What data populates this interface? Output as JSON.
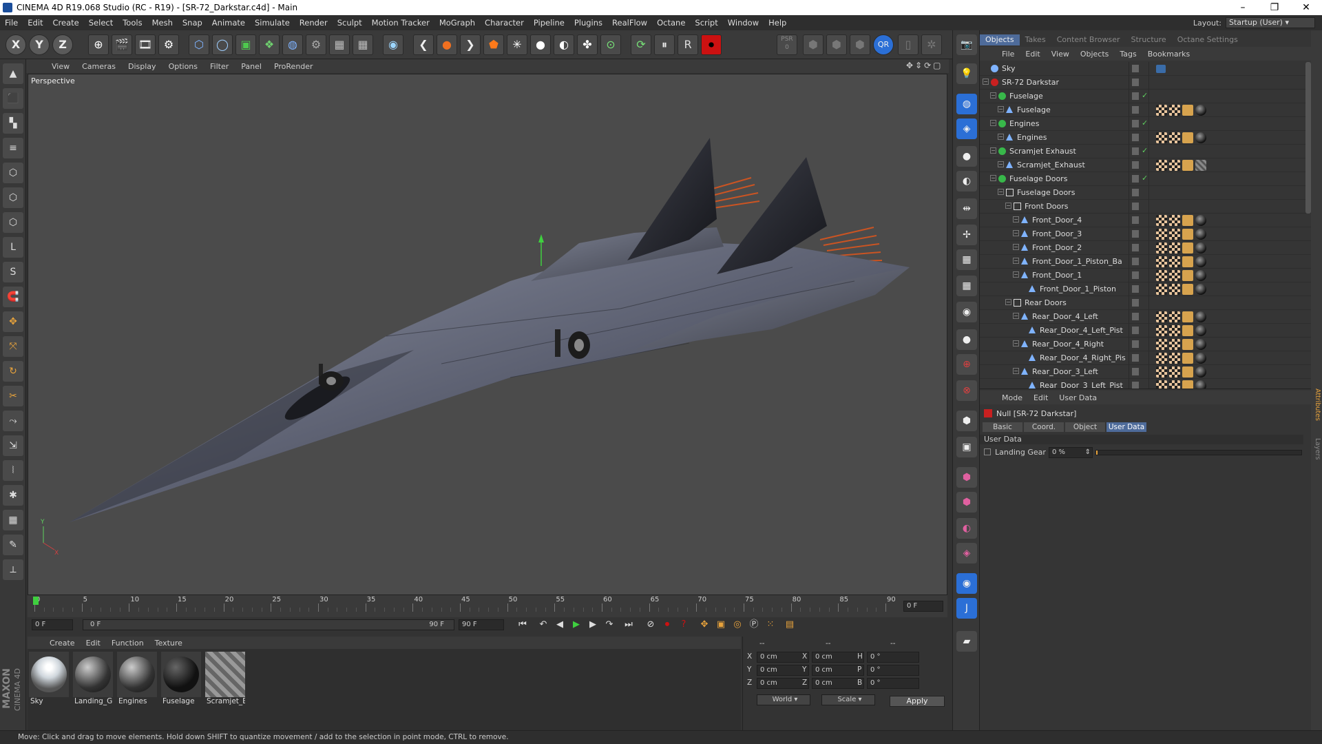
{
  "window": {
    "title": "CINEMA 4D R19.068 Studio (RC - R19) - [SR-72_Darkstar.c4d] - Main",
    "minimize": "–",
    "maximize": "❐",
    "close": "✕"
  },
  "menubar": [
    "File",
    "Edit",
    "Create",
    "Select",
    "Tools",
    "Mesh",
    "Snap",
    "Animate",
    "Simulate",
    "Render",
    "Sculpt",
    "Motion Tracker",
    "MoGraph",
    "Character",
    "Pipeline",
    "Plugins",
    "RealFlow",
    "Octane",
    "Script",
    "Window",
    "Help"
  ],
  "layout": {
    "label": "Layout:",
    "value": "Startup (User)"
  },
  "toolbar": {
    "axes": [
      "X",
      "Y",
      "Z"
    ],
    "icons": [
      "coord-system-icon",
      "render-view-icon",
      "render-picture-viewer-icon",
      "render-settings-icon",
      "cube-icon",
      "nurbs-icon",
      "array-icon",
      "deformer-icon",
      "sphere-field-icon",
      "camera-gear-icon",
      "scene-icon",
      "floor-grid-icon",
      "octane-live-icon",
      "prev-icon",
      "octane-material-icon",
      "next-icon",
      "octane-object-icon",
      "octane-settings-icon",
      "octane-light-icon",
      "octane-sphere-icon",
      "octane-arrow-icon",
      "octane-pivot-icon",
      "octane-refresh-icon",
      "octane-pause-icon",
      "octane-restart-icon",
      "octane-record-icon",
      "psr-icon",
      "qr-icon"
    ],
    "psr_label": "PSR",
    "psr_value": "0",
    "qr_label": "QR"
  },
  "viewport": {
    "menu": [
      "View",
      "Cameras",
      "Display",
      "Options",
      "Filter",
      "Panel",
      "ProRender"
    ],
    "name": "Perspective"
  },
  "timeline": {
    "ticks": [
      "0",
      "5",
      "10",
      "15",
      "20",
      "25",
      "30",
      "35",
      "40",
      "45",
      "50",
      "55",
      "60",
      "65",
      "70",
      "75",
      "80",
      "85",
      "90"
    ],
    "current_frame": "0 F"
  },
  "transport": {
    "start": "0 F",
    "range_start": "0 F",
    "range_end": "90 F",
    "end": "90 F"
  },
  "materials": {
    "menu": [
      "Create",
      "Edit",
      "Function",
      "Texture"
    ],
    "items": [
      {
        "name": "Sky",
        "style": "sky"
      },
      {
        "name": "Landing_G",
        "style": "metal"
      },
      {
        "name": "Engines",
        "style": "metal"
      },
      {
        "name": "Fuselage",
        "style": "dark"
      },
      {
        "name": "Scramjet_E",
        "style": "hatch"
      }
    ]
  },
  "coords": {
    "headers": [
      "--",
      "--",
      "--"
    ],
    "rows": [
      {
        "a": "X",
        "av": "0 cm",
        "b": "X",
        "bv": "0 cm",
        "c": "H",
        "cv": "0 °"
      },
      {
        "a": "Y",
        "av": "0 cm",
        "b": "Y",
        "bv": "0 cm",
        "c": "P",
        "cv": "0 °"
      },
      {
        "a": "Z",
        "av": "0 cm",
        "b": "Z",
        "bv": "0 cm",
        "c": "B",
        "cv": "0 °"
      }
    ],
    "mode_world": "World",
    "mode_scale": "Scale",
    "apply": "Apply"
  },
  "objects": {
    "tabs": [
      "Objects",
      "Takes",
      "Content Browser",
      "Structure",
      "Octane Settings"
    ],
    "menu": [
      "File",
      "Edit",
      "View",
      "Objects",
      "Tags",
      "Bookmarks"
    ],
    "rows": [
      {
        "name": "Sky",
        "depth": 0,
        "type": "sky",
        "check": false,
        "tags": [
          "ph"
        ]
      },
      {
        "name": "SR-72 Darkstar",
        "depth": 0,
        "type": "null",
        "check": false,
        "tags": []
      },
      {
        "name": "Fuselage",
        "depth": 1,
        "type": "green",
        "check": true,
        "tags": []
      },
      {
        "name": "Fuselage",
        "depth": 2,
        "type": "poly",
        "check": false,
        "tags": [
          "chk",
          "chk",
          "gr",
          "dk"
        ]
      },
      {
        "name": "Engines",
        "depth": 1,
        "type": "green",
        "check": true,
        "tags": []
      },
      {
        "name": "Engines",
        "depth": 2,
        "type": "poly",
        "check": false,
        "tags": [
          "chk",
          "chk",
          "gr",
          "dk"
        ]
      },
      {
        "name": "Scramjet Exhaust",
        "depth": 1,
        "type": "green",
        "check": true,
        "tags": []
      },
      {
        "name": "Scramjet_Exhaust",
        "depth": 2,
        "type": "poly",
        "check": false,
        "tags": [
          "chk",
          "chk",
          "gr",
          "hat"
        ]
      },
      {
        "name": "Fuselage Doors",
        "depth": 1,
        "type": "green",
        "check": true,
        "tags": []
      },
      {
        "name": "Fuselage Doors",
        "depth": 2,
        "type": "nullL",
        "check": false,
        "tags": []
      },
      {
        "name": "Front Doors",
        "depth": 3,
        "type": "nullL",
        "check": false,
        "tags": []
      },
      {
        "name": "Front_Door_4",
        "depth": 4,
        "type": "poly",
        "check": false,
        "tags": [
          "chk",
          "chk",
          "gr",
          "dk"
        ]
      },
      {
        "name": "Front_Door_3",
        "depth": 4,
        "type": "poly",
        "check": false,
        "tags": [
          "chk",
          "chk",
          "gr",
          "dk"
        ]
      },
      {
        "name": "Front_Door_2",
        "depth": 4,
        "type": "poly",
        "check": false,
        "tags": [
          "chk",
          "chk",
          "gr",
          "dk"
        ]
      },
      {
        "name": "Front_Door_1_Piston_Ba",
        "depth": 4,
        "type": "poly",
        "check": false,
        "tags": [
          "chk",
          "chk",
          "gr",
          "dk"
        ]
      },
      {
        "name": "Front_Door_1",
        "depth": 4,
        "type": "poly",
        "check": false,
        "tags": [
          "chk",
          "chk",
          "gr",
          "dk"
        ]
      },
      {
        "name": "Front_Door_1_Piston",
        "depth": 5,
        "type": "poly",
        "check": false,
        "tags": [
          "chk",
          "chk",
          "gr",
          "dk"
        ]
      },
      {
        "name": "Rear Doors",
        "depth": 3,
        "type": "nullL",
        "check": false,
        "tags": []
      },
      {
        "name": "Rear_Door_4_Left",
        "depth": 4,
        "type": "poly",
        "check": false,
        "tags": [
          "chk",
          "chk",
          "gr",
          "dk"
        ]
      },
      {
        "name": "Rear_Door_4_Left_Pist",
        "depth": 5,
        "type": "poly",
        "check": false,
        "tags": [
          "chk",
          "chk",
          "gr",
          "dk"
        ]
      },
      {
        "name": "Rear_Door_4_Right",
        "depth": 4,
        "type": "poly",
        "check": false,
        "tags": [
          "chk",
          "chk",
          "gr",
          "dk"
        ]
      },
      {
        "name": "Rear_Door_4_Right_Pis",
        "depth": 5,
        "type": "poly",
        "check": false,
        "tags": [
          "chk",
          "chk",
          "gr",
          "dk"
        ]
      },
      {
        "name": "Rear_Door_3_Left",
        "depth": 4,
        "type": "poly",
        "check": false,
        "tags": [
          "chk",
          "chk",
          "gr",
          "dk"
        ]
      },
      {
        "name": "Rear_Door_3_Left_Pist",
        "depth": 5,
        "type": "poly",
        "check": false,
        "tags": [
          "chk",
          "chk",
          "gr",
          "dk"
        ]
      }
    ]
  },
  "attributes": {
    "menu": [
      "Mode",
      "Edit",
      "User Data"
    ],
    "title": "Null [SR-72 Darkstar]",
    "tabs": [
      "Basic",
      "Coord.",
      "Object",
      "User Data"
    ],
    "active_tab": "User Data",
    "section": "User Data",
    "field_label": "Landing Gear",
    "field_value": "0 %",
    "slider_fraction": 0
  },
  "right_tabs": [
    "Attributes",
    "Layers"
  ],
  "brand": {
    "line1": "MAXON",
    "line2": "CINEMA 4D"
  },
  "status": "Move: Click and drag to move elements. Hold down SHIFT to quantize movement / add to the selection in point mode, CTRL to remove.",
  "colors": {
    "accent": "#4e6b9a",
    "check": "#5fd05f",
    "record": "#cc1111",
    "playhead": "#3fd03f"
  }
}
